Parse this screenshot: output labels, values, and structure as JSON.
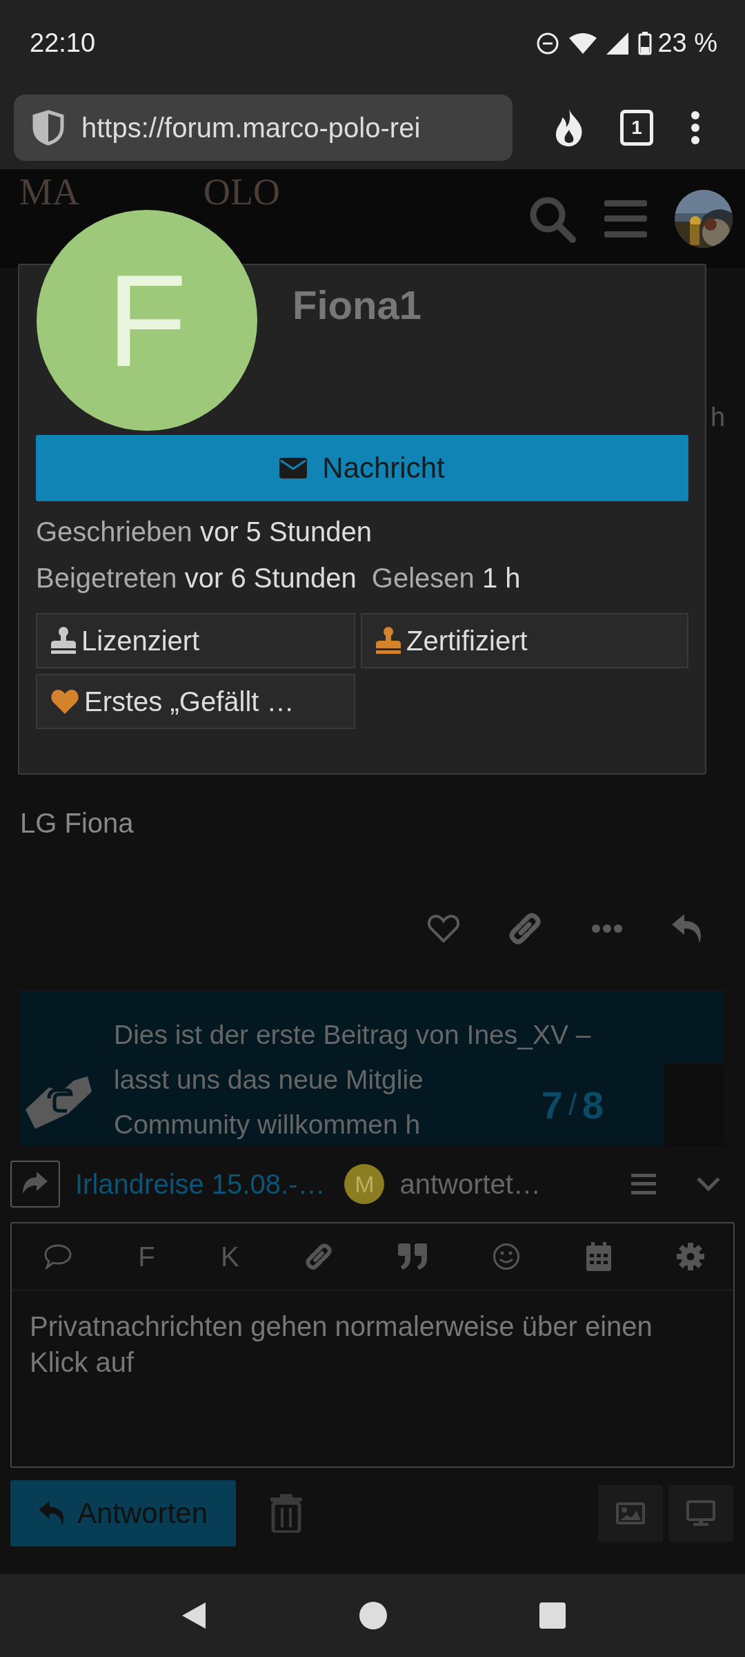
{
  "status_bar": {
    "time": "22:10",
    "battery": "23 %"
  },
  "browser": {
    "url": "https://forum.marco-polo-rei",
    "tab_count": "1"
  },
  "site_header": {
    "logo_parts": [
      "MA",
      "OLO"
    ]
  },
  "user_card": {
    "avatar_letter": "F",
    "username": "Fiona1",
    "message_button": "Nachricht",
    "stats": [
      [
        {
          "label": "Geschrieben",
          "value": "vor 5 Stunden"
        }
      ],
      [
        {
          "label": "Beigetreten",
          "value": "vor 6 Stunden"
        },
        {
          "label": "Gelesen",
          "value": "1 h"
        }
      ]
    ],
    "badges": [
      {
        "kind": "stamp",
        "label": "Lizenziert",
        "color": "#c8c8c8"
      },
      {
        "kind": "stamp",
        "label": "Zertifiziert",
        "color": "#d4822c"
      },
      {
        "kind": "heart",
        "label": "Erstes „Gefällt …",
        "color": "#d4822c"
      }
    ]
  },
  "post": {
    "meta_fragment": "h",
    "body": "LG Fiona"
  },
  "notice": {
    "lines": [
      "Dies ist der erste Beitrag von Ines_XV –",
      "lasst uns das neue Mitglie",
      "Community willkommen h"
    ]
  },
  "progress": {
    "current": "7",
    "separator": "/",
    "total": "8"
  },
  "composer": {
    "topic": "Irlandreise 15.08.-…",
    "user_letter": "M",
    "action": "antwortet…",
    "toolbar": [
      {
        "kind": "bubble"
      },
      {
        "kind": "text",
        "label": "F"
      },
      {
        "kind": "text",
        "label": "K"
      },
      {
        "kind": "link"
      },
      {
        "kind": "quote"
      },
      {
        "kind": "smiley"
      },
      {
        "kind": "calendar"
      },
      {
        "kind": "gear"
      }
    ],
    "text": "Privatnachrichten gehen normalerweise über einen Klick auf",
    "submit": "Antworten"
  }
}
